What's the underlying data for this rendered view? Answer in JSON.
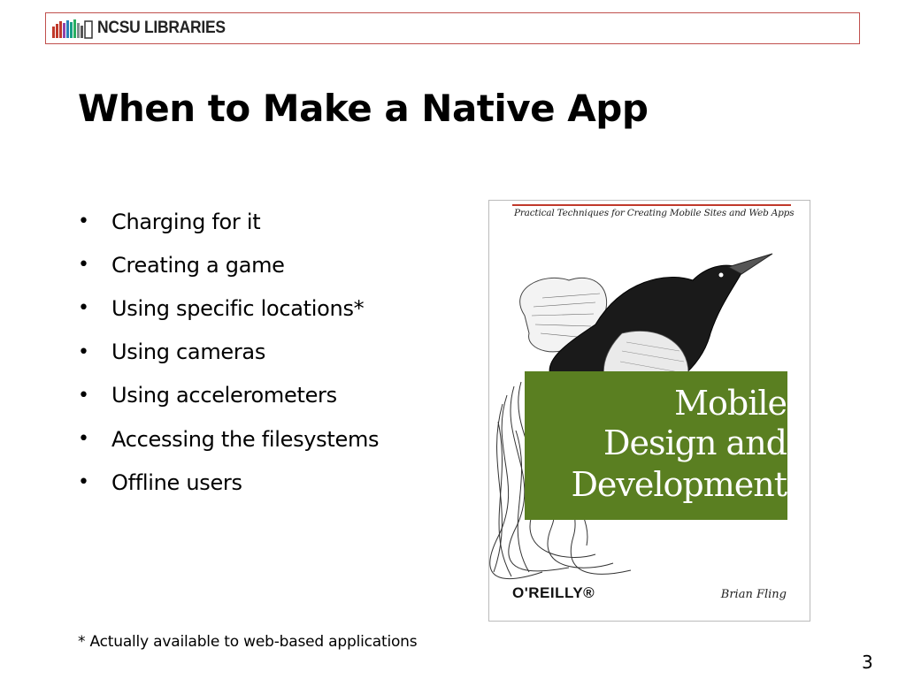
{
  "header": {
    "logo_text": "NCSU LIBRARIES",
    "border_color": "#c0504d"
  },
  "title": "When to Make a Native App",
  "bullets": [
    "Charging for it",
    "Creating a game",
    "Using specific locations*",
    "Using cameras",
    "Using accelerometers",
    "Accessing the filesystems",
    "Offline users"
  ],
  "bullet_glyph": "•",
  "footnote": "* Actually available to web-based applications",
  "page_number": "3",
  "book": {
    "tagline": "Practical Techniques for Creating Mobile Sites and Web Apps",
    "title_lines": [
      "Mobile",
      "Design and",
      "Development"
    ],
    "publisher": "O'REILLY®",
    "author": "Brian Fling",
    "panel_color": "#5a7f21"
  }
}
